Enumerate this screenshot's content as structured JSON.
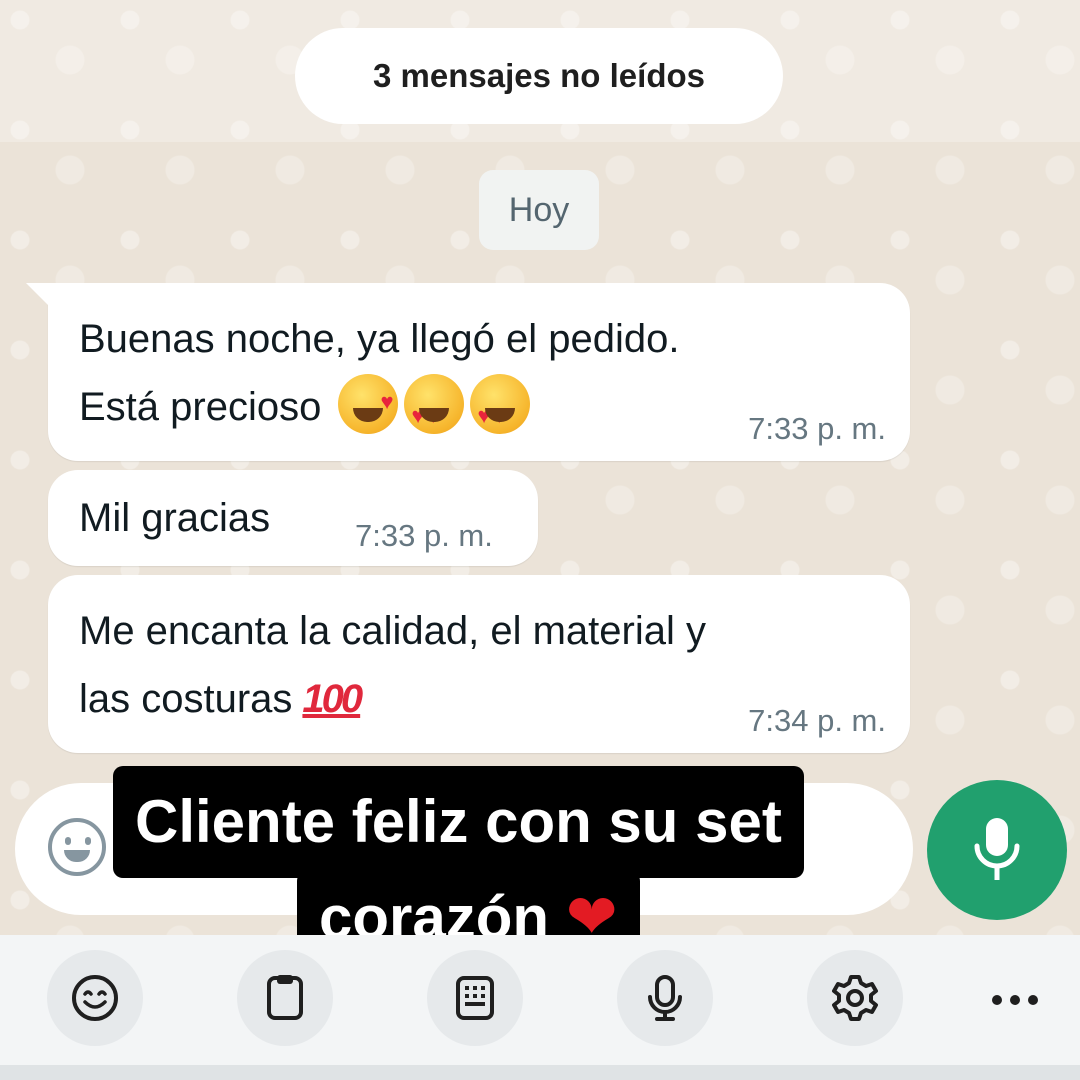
{
  "unread_banner": "3 mensajes no leídos",
  "date_chip": "Hoy",
  "messages": [
    {
      "line1": "Buenas noche, ya llegó el pedido.",
      "line2": "Está precioso",
      "emojis": [
        "smiling-face-with-hearts",
        "heart-eyes",
        "heart-eyes"
      ],
      "time": "7:33 p. m."
    },
    {
      "line1": "Mil gracias",
      "time": "7:33 p. m."
    },
    {
      "line1": "Me encanta la calidad, el material y",
      "line2": "las costuras",
      "emojis": [
        "hundred-points"
      ],
      "hundred_text": "100",
      "time": "7:34 p. m."
    }
  ],
  "caption": {
    "line1": "Cliente feliz con su set",
    "line2": "corazón",
    "heart": "❤"
  },
  "composer": {
    "emoji_icon": "smiley-icon",
    "mic_icon": "microphone-icon"
  },
  "keyboard_toolbar": [
    "emoji-icon",
    "clipboard-icon",
    "keypad-icon",
    "microphone-icon",
    "settings-icon",
    "more-icon"
  ],
  "colors": {
    "accent": "#21a06e",
    "chat_background": "#ebe3d8",
    "bubble": "#ffffff",
    "timestamp": "#667781"
  }
}
